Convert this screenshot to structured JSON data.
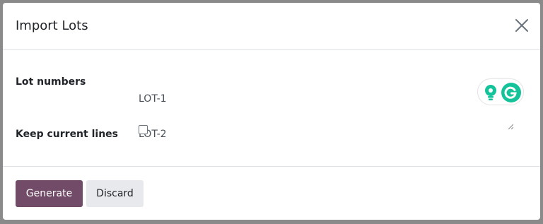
{
  "dialog": {
    "title": "Import Lots"
  },
  "form": {
    "lot_numbers_label": "Lot numbers",
    "lot_numbers_lines": [
      "LOT-1",
      "LOT-2"
    ],
    "keep_current_lines_label": "Keep current lines",
    "keep_current_lines_checked": false
  },
  "footer": {
    "generate_label": "Generate",
    "discard_label": "Discard"
  },
  "colors": {
    "primary": "#714b67",
    "secondary": "#e7e9ed",
    "grammarly": "#15c39a"
  },
  "icons": {
    "close": "close-icon",
    "grammarly_bulb": "lightbulb-icon",
    "grammarly_logo": "grammarly-logo-icon"
  }
}
